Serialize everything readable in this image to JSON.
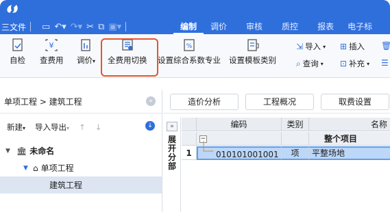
{
  "titlebar": {
    "menu_file": "三文件",
    "quick_icons": [
      "save-icon",
      "undo-icon",
      "redo-icon",
      "cut-icon",
      "copy-icon",
      "paste-icon"
    ],
    "tabs": [
      {
        "label": "编制",
        "active": true
      },
      {
        "label": "调价",
        "active": false
      },
      {
        "label": "审核",
        "active": false
      },
      {
        "label": "质控",
        "active": false
      },
      {
        "label": "报表",
        "active": false
      },
      {
        "label": "电子标",
        "active": false
      }
    ]
  },
  "ribbon": {
    "buttons": [
      {
        "label": "自检",
        "icon": "check-doc-icon"
      },
      {
        "label": "查费用",
        "icon": "fee-lookup-icon"
      },
      {
        "label": "调价",
        "icon": "price-adjust-icon",
        "dropdown": true
      },
      {
        "label": "全费用切换",
        "icon": "full-fee-switch-icon",
        "highlighted": true
      },
      {
        "label": "设置综合系数专业",
        "icon": "coefficient-icon"
      },
      {
        "label": "设置模板类别",
        "icon": "template-icon"
      }
    ],
    "small_buttons": [
      {
        "label": "导入",
        "icon": "import-icon",
        "dropdown": true
      },
      {
        "label": "插入",
        "icon": "insert-icon"
      },
      {
        "label": "查询",
        "icon": "query-icon",
        "dropdown": true
      },
      {
        "label": "补充",
        "icon": "supplement-icon",
        "dropdown": true
      }
    ],
    "highlight_color": "#e5532e"
  },
  "left_panel": {
    "breadcrumb": "单项工程 > 建筑工程",
    "toolbar": {
      "new": "新建",
      "import_export": "导入导出",
      "up": "↑",
      "down": "↓"
    },
    "tree": [
      {
        "label": "未命名",
        "level": 0,
        "icon": "building-icon"
      },
      {
        "label": "单项工程",
        "level": 1,
        "icon": "home-icon"
      },
      {
        "label": "建筑工程",
        "level": 2,
        "selected": true
      }
    ]
  },
  "right_panel": {
    "buttons": [
      "造价分析",
      "工程概况",
      "取费设置"
    ],
    "side_expand": "»",
    "side_label": "展开分部",
    "grid": {
      "columns": [
        "编码",
        "类别",
        "名称"
      ],
      "rows": [
        {
          "index": "",
          "code": "",
          "type": "",
          "name": "整个项目",
          "summary": true
        },
        {
          "index": "1",
          "code": "010101001001",
          "type": "项",
          "name": "平整场地",
          "selected": true
        }
      ]
    }
  },
  "colors": {
    "brand": "#2f6fdc",
    "selection": "#dde5f3",
    "row_highlight": "#7fb3ef"
  }
}
